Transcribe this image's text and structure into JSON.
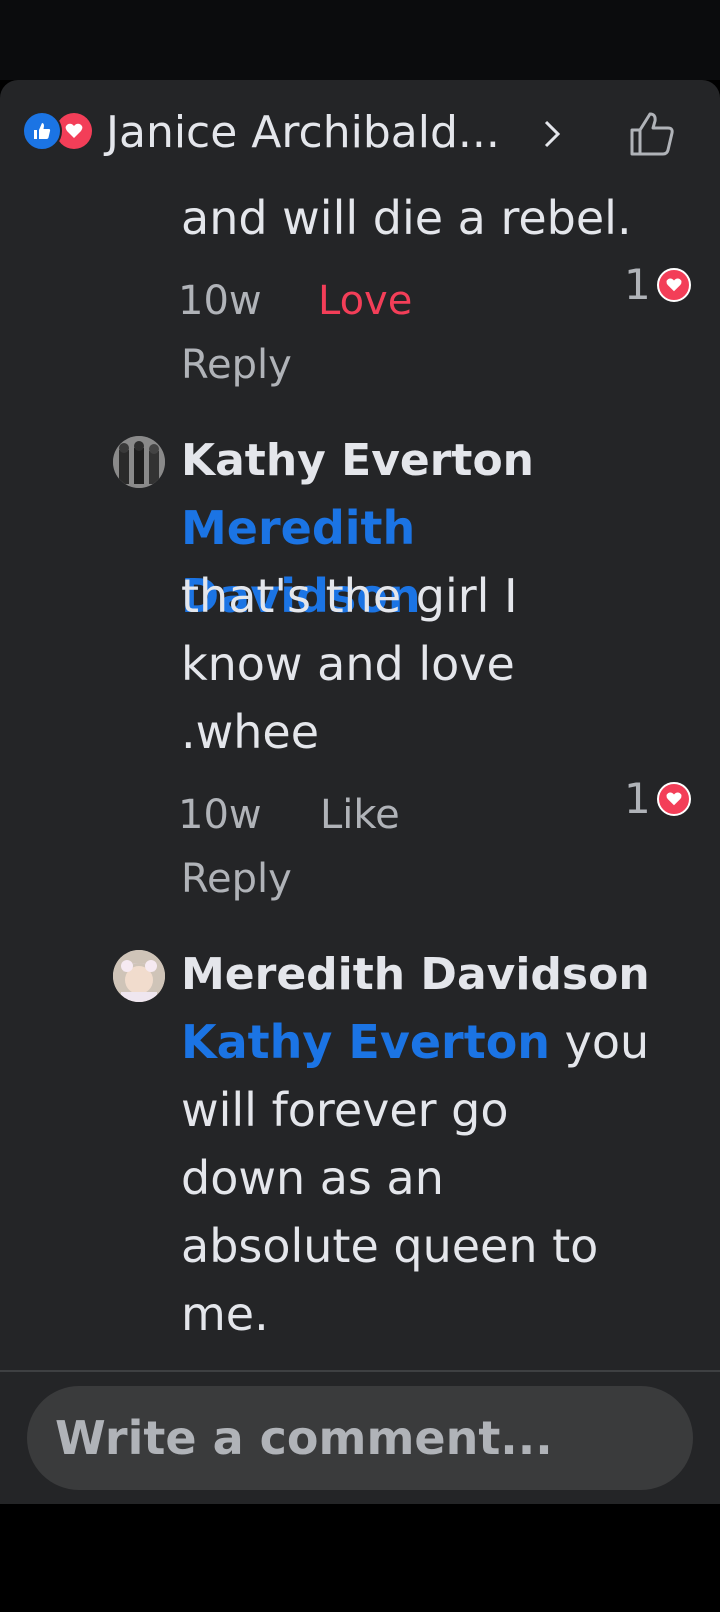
{
  "header": {
    "name": "Janice Archibald..."
  },
  "comments": [
    {
      "text_tail": "and will die a rebel.",
      "time": "10w",
      "action": "Love",
      "reply": "Reply",
      "reaction_count": "1"
    },
    {
      "author": "Kathy Everton",
      "mention": "Meredith Davidson",
      "text_lines": [
        "that's the girl I",
        "know and love",
        ".whee"
      ],
      "time": "10w",
      "action": "Like",
      "reply": "Reply",
      "reaction_count": "1"
    },
    {
      "author": "Meredith Davidson",
      "mention": "Kathy Everton",
      "text_first": " you",
      "text_lines": [
        "will forever go",
        "down as an",
        "absolute queen to",
        "me."
      ]
    }
  ],
  "composer": {
    "placeholder": "Write a comment..."
  },
  "colors": {
    "background": "#242527",
    "mention": "#1b74e4",
    "love": "#f33e58",
    "text": "#e4e6eb",
    "meta": "#b0b3b8"
  }
}
